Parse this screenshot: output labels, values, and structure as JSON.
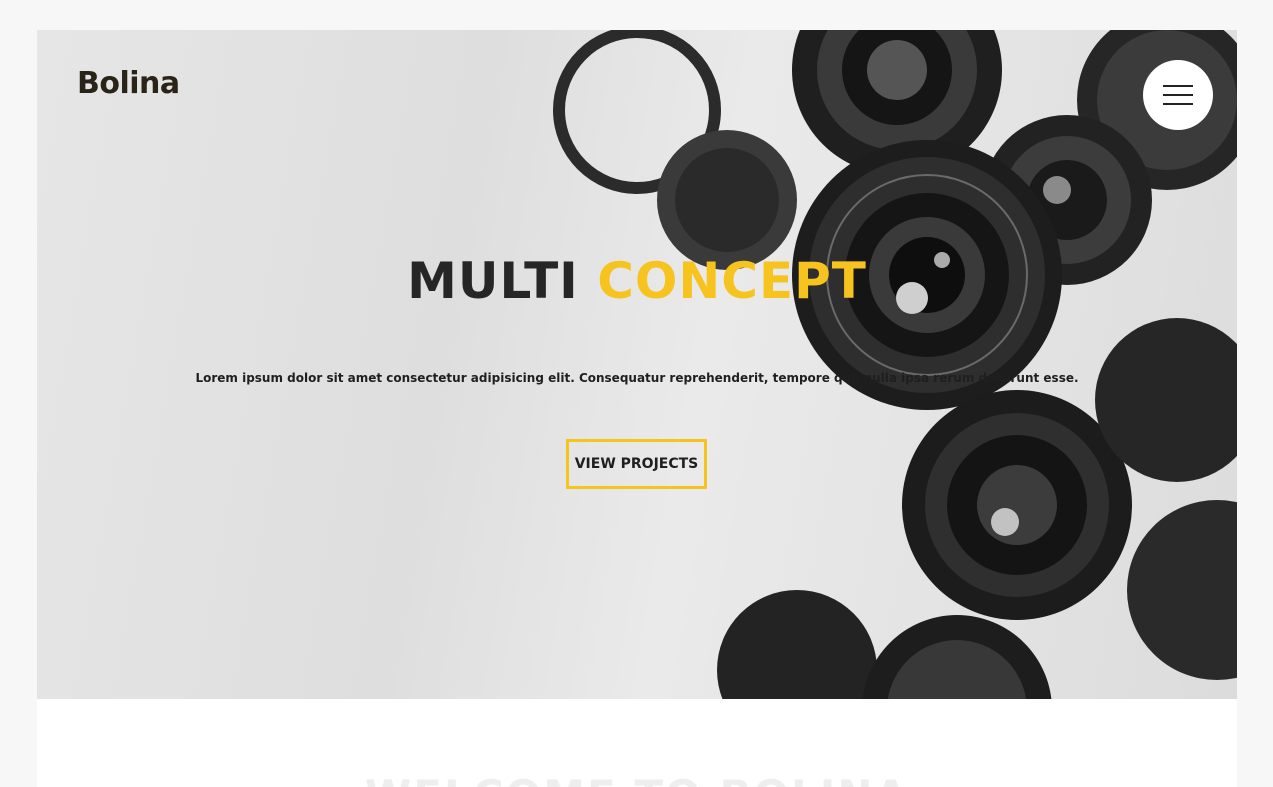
{
  "brand": {
    "name": "Bolina"
  },
  "menu": {
    "icon": "hamburger-menu-icon"
  },
  "hero": {
    "title_main": "MULTI",
    "title_accent": "CONCEPT",
    "text": "Lorem ipsum dolor sit amet consectetur adipisicing elit. Consequatur reprehenderit, tempore quo nulla ipsa rerum deserunt esse.",
    "cta_label": "VIEW PROJECTS",
    "background": "camera-lenses-photo"
  },
  "welcome": {
    "title": "WELCOME TO BOLINA"
  },
  "colors": {
    "accent": "#f7c31f",
    "text_dark": "#262626",
    "page_bg": "#f7f7f7"
  }
}
